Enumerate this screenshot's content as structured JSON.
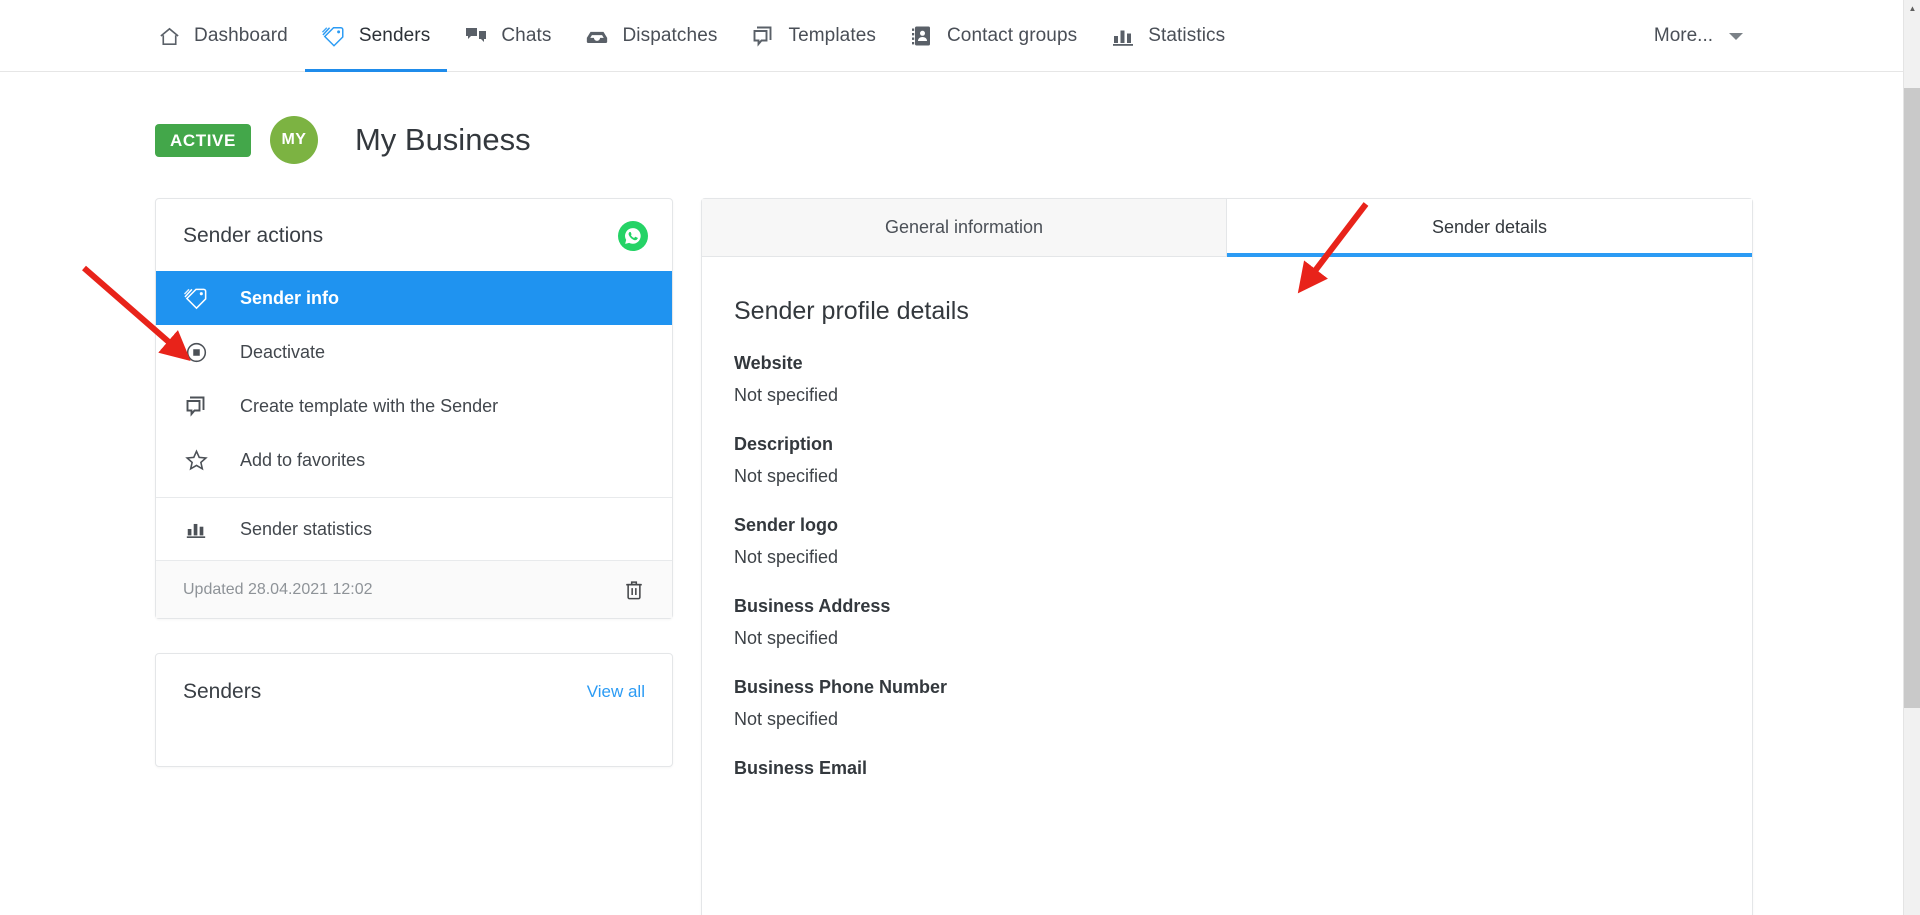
{
  "nav": {
    "items": [
      {
        "label": "Dashboard",
        "icon": "home-icon",
        "active": false
      },
      {
        "label": "Senders",
        "icon": "tag-icon",
        "active": true
      },
      {
        "label": "Chats",
        "icon": "chat-icon",
        "active": false
      },
      {
        "label": "Dispatches",
        "icon": "inbox-icon",
        "active": false
      },
      {
        "label": "Templates",
        "icon": "templates-icon",
        "active": false
      },
      {
        "label": "Contact groups",
        "icon": "contacts-book-icon",
        "active": false
      },
      {
        "label": "Statistics",
        "icon": "bar-chart-icon",
        "active": false
      }
    ],
    "more_label": "More..."
  },
  "header": {
    "status_badge": "ACTIVE",
    "avatar_initials": "MY",
    "title": "My Business"
  },
  "sender_actions": {
    "card_title": "Sender actions",
    "channel_icon": "whatsapp-icon",
    "items": [
      {
        "label": "Sender info",
        "icon": "tag-icon",
        "selected": true
      },
      {
        "label": "Deactivate",
        "icon": "stop-circle-icon",
        "selected": false
      },
      {
        "label": "Create template with the Sender",
        "icon": "templates-icon",
        "selected": false
      },
      {
        "label": "Add to favorites",
        "icon": "star-icon",
        "selected": false
      }
    ],
    "statistics_item": {
      "label": "Sender statistics",
      "icon": "bar-chart-icon"
    },
    "updated_text": "Updated 28.04.2021 12:02",
    "delete_icon": "trash-icon"
  },
  "senders_card": {
    "title": "Senders",
    "view_all_label": "View all"
  },
  "details_panel": {
    "tabs": [
      {
        "label": "General information",
        "active": false
      },
      {
        "label": "Sender details",
        "active": true
      }
    ],
    "title": "Sender profile details",
    "fields": [
      {
        "label": "Website",
        "value": "Not specified"
      },
      {
        "label": "Description",
        "value": "Not specified"
      },
      {
        "label": "Sender logo",
        "value": "Not specified"
      },
      {
        "label": "Business Address",
        "value": "Not specified"
      },
      {
        "label": "Business Phone Number",
        "value": "Not specified"
      },
      {
        "label": "Business Email",
        "value": ""
      }
    ]
  },
  "colors": {
    "accent_blue": "#2b9bf4",
    "selected_blue": "#1f93f0",
    "active_green": "#43a74a",
    "avatar_green": "#7cb342",
    "whatsapp_green": "#25d366",
    "annotation_red": "#e8231a"
  },
  "annotations": {
    "arrow_sidebar": "red-arrow-icon",
    "arrow_tab": "red-arrow-icon"
  }
}
